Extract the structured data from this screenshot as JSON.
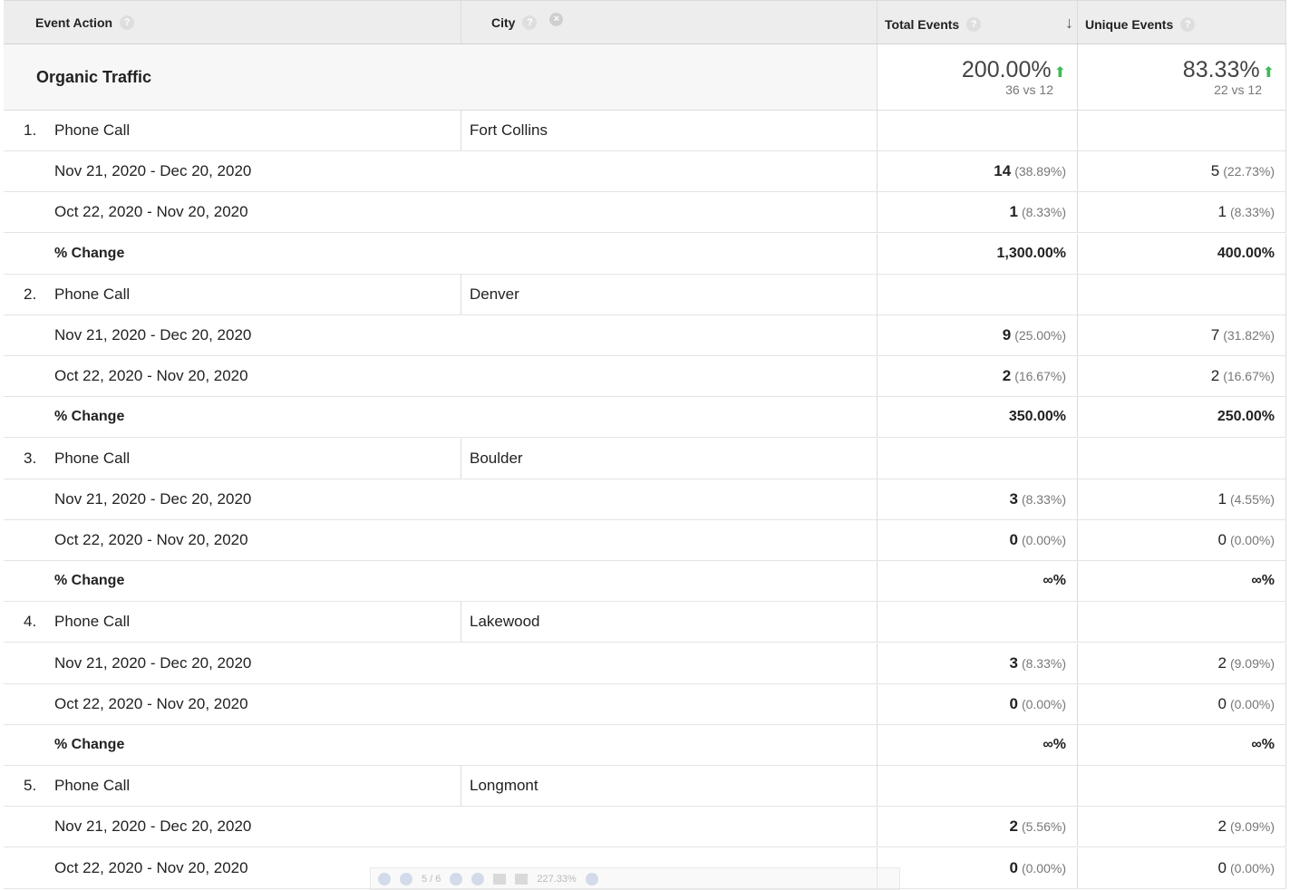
{
  "header": {
    "event_action": "Event Action",
    "city": "City",
    "total_events": "Total Events",
    "unique_events": "Unique Events",
    "help_glyph": "?",
    "remove_glyph": "⊗",
    "sort_glyph": "↓"
  },
  "summary": {
    "label": "Organic Traffic",
    "total_pct": "200.00%",
    "total_sub": "36 vs 12",
    "unique_pct": "83.33%",
    "unique_sub": "22 vs 12",
    "arrow_glyph": "⬆"
  },
  "rows": [
    {
      "index": "1.",
      "action": "Phone Call",
      "city": "Fort Collins",
      "cur": {
        "range": "Nov 21, 2020 - Dec 20, 2020",
        "total": "14",
        "total_pct": "(38.89%)",
        "unique": "5",
        "unique_pct": "(22.73%)"
      },
      "prev": {
        "range": "Oct 22, 2020 - Nov 20, 2020",
        "total": "1",
        "total_pct": "(8.33%)",
        "unique": "1",
        "unique_pct": "(8.33%)"
      },
      "change": {
        "label": "% Change",
        "total": "1,300.00%",
        "unique": "400.00%"
      }
    },
    {
      "index": "2.",
      "action": "Phone Call",
      "city": "Denver",
      "cur": {
        "range": "Nov 21, 2020 - Dec 20, 2020",
        "total": "9",
        "total_pct": "(25.00%)",
        "unique": "7",
        "unique_pct": "(31.82%)"
      },
      "prev": {
        "range": "Oct 22, 2020 - Nov 20, 2020",
        "total": "2",
        "total_pct": "(16.67%)",
        "unique": "2",
        "unique_pct": "(16.67%)"
      },
      "change": {
        "label": "% Change",
        "total": "350.00%",
        "unique": "250.00%"
      }
    },
    {
      "index": "3.",
      "action": "Phone Call",
      "city": "Boulder",
      "cur": {
        "range": "Nov 21, 2020 - Dec 20, 2020",
        "total": "3",
        "total_pct": "(8.33%)",
        "unique": "1",
        "unique_pct": "(4.55%)"
      },
      "prev": {
        "range": "Oct 22, 2020 - Nov 20, 2020",
        "total": "0",
        "total_pct": "(0.00%)",
        "unique": "0",
        "unique_pct": "(0.00%)"
      },
      "change": {
        "label": "% Change",
        "total": "∞%",
        "unique": "∞%"
      }
    },
    {
      "index": "4.",
      "action": "Phone Call",
      "city": "Lakewood",
      "cur": {
        "range": "Nov 21, 2020 - Dec 20, 2020",
        "total": "3",
        "total_pct": "(8.33%)",
        "unique": "2",
        "unique_pct": "(9.09%)"
      },
      "prev": {
        "range": "Oct 22, 2020 - Nov 20, 2020",
        "total": "0",
        "total_pct": "(0.00%)",
        "unique": "0",
        "unique_pct": "(0.00%)"
      },
      "change": {
        "label": "% Change",
        "total": "∞%",
        "unique": "∞%"
      }
    },
    {
      "index": "5.",
      "action": "Phone Call",
      "city": "Longmont",
      "cur": {
        "range": "Nov 21, 2020 - Dec 20, 2020",
        "total": "2",
        "total_pct": "(5.56%)",
        "unique": "2",
        "unique_pct": "(9.09%)"
      },
      "prev": {
        "range": "Oct 22, 2020 - Nov 20, 2020",
        "total": "0",
        "total_pct": "(0.00%)",
        "unique": "0",
        "unique_pct": "(0.00%)"
      },
      "change": null
    }
  ],
  "pdf_toolbar": {
    "page": "5 / 6",
    "zoom": "227.33%"
  }
}
